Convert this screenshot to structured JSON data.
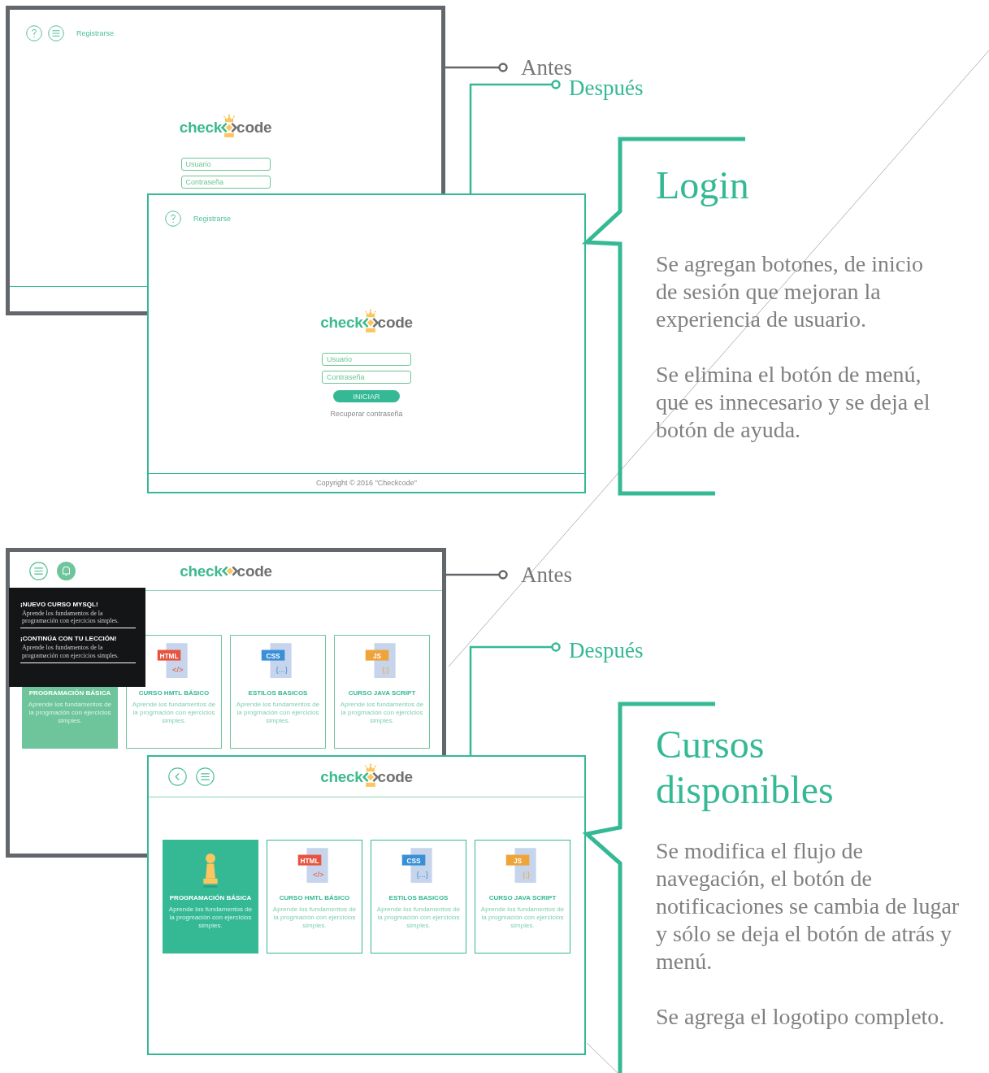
{
  "sections": [
    {
      "before_label": "Antes",
      "after_label": "Después",
      "title": "Login",
      "paragraphs": [
        "Se agregan botones, de inicio de sesión que mejoran la experiencia de usuario.",
        "Se elimina el botón de menú, que es innecesario y se deja el botón de ayuda."
      ],
      "before": {
        "kind": "login",
        "header_buttons": [
          {
            "kind": "help"
          },
          {
            "kind": "menu"
          }
        ],
        "header_link": "Registrarse",
        "logo": {
          "left": "check",
          "right": "code",
          "crown": true
        },
        "fields": [
          {
            "placeholder": "Usuario"
          },
          {
            "placeholder": "Contraseña"
          }
        ]
      },
      "after": {
        "kind": "login",
        "header_buttons": [
          {
            "kind": "help"
          }
        ],
        "header_link": "Registrarse",
        "logo": {
          "left": "check",
          "right": "code",
          "crown": true
        },
        "fields": [
          {
            "placeholder": "Usuario"
          },
          {
            "placeholder": "Contraseña"
          }
        ],
        "button": "INICIAR",
        "recover_link": "Recuperar contraseña",
        "copyright": "Copyright © 2016 \"Checkcode\""
      }
    },
    {
      "before_label": "Antes",
      "after_label": "Después",
      "title": "Cursos disponibles",
      "paragraphs": [
        "Se modifica el flujo de navegación, el botón de notificaciones se cambia de lugar y sólo se deja el botón de atrás y menú.",
        "Se agrega el logotipo completo."
      ],
      "before": {
        "kind": "courses",
        "header_buttons": [
          {
            "kind": "menu"
          },
          {
            "kind": "bell"
          }
        ],
        "logo": {
          "left": "check",
          "right": "code",
          "crown": false
        },
        "notifications": [
          {
            "title": "¡NUEVO CURSO MYSQL!",
            "text": "Aprende los fundamentos de la programación con ejercicios simples."
          },
          {
            "title": "¡CONTINÚA CON TU LECCIÓN!",
            "text": "Aprende los fundamentos de la programación con ejercicios simples."
          }
        ],
        "cards": [
          {
            "kind": "text",
            "title": "PROGRAMACIÓN BÁSICA",
            "description": "Aprende los fundamentos de la progmación con ejercicios simples.",
            "selected": true
          },
          {
            "kind": "file",
            "badge": "HTML",
            "symbol": "</>",
            "color": "#e8533f",
            "title": "CURSO HMTL BÁSICO",
            "description": "Aprende los fundamentos de la progmación con ejercicios simples.",
            "selected": false
          },
          {
            "kind": "file",
            "badge": "CSS",
            "symbol": "{...}",
            "color": "#3a8fd6",
            "title": "ESTILOS BASICOS",
            "description": "Aprende los fundamentos de la progmación con ejercicios simples.",
            "selected": false
          },
          {
            "kind": "file",
            "badge": "JS",
            "symbol": "{;}",
            "color": "#eea43a",
            "title": "CURSO JAVA SCRIPT",
            "description": "Aprende los fundamentos de la progmación con ejercicios simples.",
            "selected": false
          }
        ]
      },
      "after": {
        "kind": "courses",
        "header_buttons": [
          {
            "kind": "back"
          },
          {
            "kind": "menu"
          }
        ],
        "logo": {
          "left": "check",
          "right": "code",
          "crown": true
        },
        "cards": [
          {
            "kind": "pawn",
            "title": "PROGRAMACIÓN BÁSICA",
            "description": "Aprende los fundamentos de la progmación con ejercicios simples.",
            "selected": true
          },
          {
            "kind": "file",
            "badge": "HTML",
            "symbol": "</>",
            "color": "#e8533f",
            "title": "CURSO HMTL BÁSICO",
            "description": "Aprende los fundamentos de la progmación con ejercicios simples.",
            "selected": false
          },
          {
            "kind": "file",
            "badge": "CSS",
            "symbol": "{...}",
            "color": "#3a8fd6",
            "title": "ESTILOS BASICOS",
            "description": "Aprende los fundamentos de la progmación con ejercicios simples.",
            "selected": false
          },
          {
            "kind": "file",
            "badge": "JS",
            "symbol": "{;}",
            "color": "#eea43a",
            "title": "CURSO JAVA SCRIPT",
            "description": "Aprende los fundamentos de la progmación con ejercicios simples.",
            "selected": false
          }
        ]
      }
    }
  ]
}
